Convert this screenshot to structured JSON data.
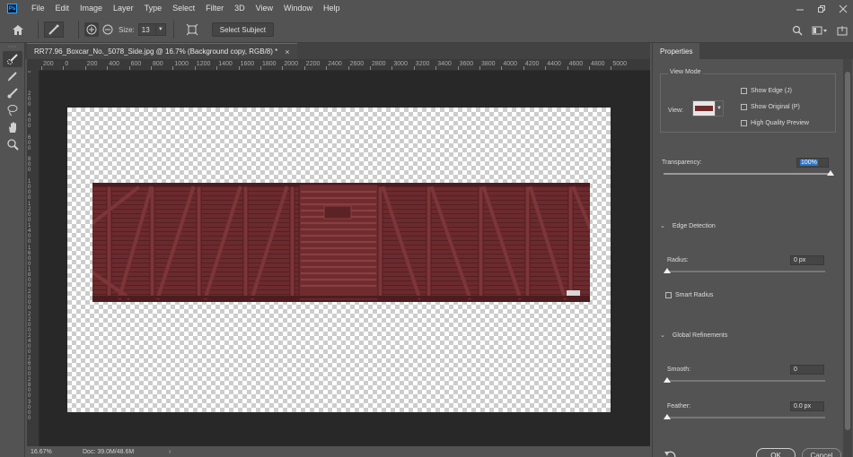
{
  "app": {
    "logo": "Ps",
    "menu": [
      "File",
      "Edit",
      "Image",
      "Layer",
      "Type",
      "Select",
      "Filter",
      "3D",
      "View",
      "Window",
      "Help"
    ]
  },
  "options": {
    "size_label": "Size:",
    "size_value": "13",
    "select_subject": "Select Subject"
  },
  "document": {
    "tab_title": "RR77.96_Boxcar_No._5078_Side.jpg @ 16.7% (Background copy, RGB/8) *",
    "close_glyph": "×",
    "ruler_h": [
      "200",
      "0",
      "200",
      "400",
      "600",
      "800",
      "1000",
      "1200",
      "1400",
      "1600",
      "1800",
      "2000",
      "2200",
      "2400",
      "2600",
      "2800",
      "3000",
      "3200",
      "3400",
      "3600",
      "3800",
      "4000",
      "4200",
      "4400",
      "4600",
      "4800",
      "5000"
    ],
    "ruler_v": [
      "0",
      "2 0 0",
      "4 0 0",
      "6 0 0",
      "8 0 0",
      "1 0 0 0",
      "1 2 0 0",
      "1 4 0 0",
      "1 6 0 0",
      "1 8 0 0",
      "2 0 0 0",
      "2 2 0 0",
      "2 4 0 0",
      "2 6 0 0",
      "2 8 0 0",
      "3 0 0 0"
    ]
  },
  "status": {
    "zoom": "16.67%",
    "doc_size": "Doc: 39.0M/48.6M",
    "arrow": "›"
  },
  "properties": {
    "tab": "Properties",
    "view_mode": {
      "title": "View Mode",
      "view_label": "View:",
      "show_edge": "Show Edge (J)",
      "show_original": "Show Original (P)",
      "high_quality": "High Quality Preview"
    },
    "transparency": {
      "label": "Transparency:",
      "value": "100%",
      "level": 1.0
    },
    "edge_detection": {
      "title": "Edge Detection",
      "radius_label": "Radius:",
      "radius_value": "0 px",
      "radius_level": 0.0,
      "smart_radius": "Smart Radius"
    },
    "global_refinements": {
      "title": "Global Refinements",
      "smooth_label": "Smooth:",
      "smooth_value": "0",
      "smooth_level": 0.0,
      "feather_label": "Feather:",
      "feather_value": "0.0 px",
      "feather_level": 0.0
    },
    "ok": "OK",
    "cancel": "Cancel"
  },
  "colors": {
    "boxcar": "#6b2a2d",
    "boxcar_dark": "#4e1c1f",
    "boxcar_light": "#7c3538",
    "selection": "#2e74c7"
  }
}
